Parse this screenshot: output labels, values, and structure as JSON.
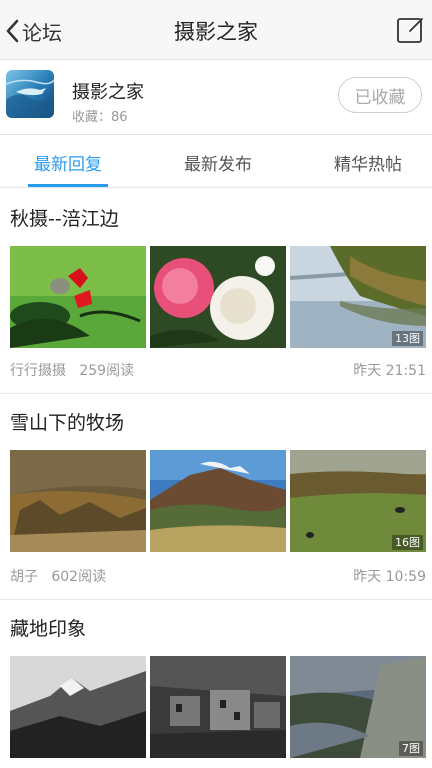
{
  "nav": {
    "back_label": "论坛",
    "title": "摄影之家",
    "back_icon": "chevron-left-icon",
    "compose_icon": "compose-icon"
  },
  "forum": {
    "name": "摄影之家",
    "favorites_text": "收藏：86",
    "fav_button": "已收藏"
  },
  "tabs": [
    {
      "label": "最新回复",
      "active": true
    },
    {
      "label": "最新发布",
      "active": false
    },
    {
      "label": "精华热帖",
      "active": false
    }
  ],
  "posts": [
    {
      "title": "秋摄--涪江边",
      "author": "行行摄摄",
      "reads": "259阅读",
      "time": "昨天 21:51",
      "image_count": "13图"
    },
    {
      "title": "雪山下的牧场",
      "author": "胡子",
      "reads": "602阅读",
      "time": "昨天 10:59",
      "image_count": "16图"
    },
    {
      "title": "藏地印象",
      "image_count": "7图"
    }
  ],
  "colors": {
    "accent": "#2a9cf0",
    "muted_text": "#999999"
  }
}
